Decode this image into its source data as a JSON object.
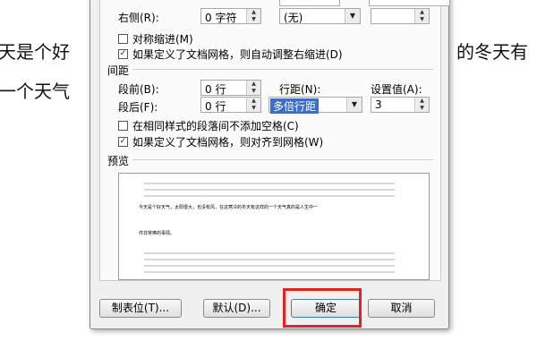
{
  "background": {
    "line1_left": "天是个好",
    "line1_right": "的冬天有",
    "line2_left": "一个天气"
  },
  "dialog": {
    "indent": {
      "right_label": "右侧(R):",
      "right_value": "0 字符",
      "special_value": "(无)",
      "by_value": "",
      "mirror_indent_label": "对称缩进(M)",
      "mirror_indent_checked": false,
      "auto_adjust_label": "如果定义了文档网格，则自动调整右缩进(D)",
      "auto_adjust_checked": true
    },
    "spacing": {
      "title": "间距",
      "before_label": "段前(B):",
      "before_value": "0 行",
      "after_label": "段后(F):",
      "after_value": "0 行",
      "line_spacing_label": "行距(N):",
      "line_spacing_value": "多倍行距",
      "set_value_label": "设置值(A):",
      "set_value": "3",
      "no_space_same_style_label": "在相同样式的段落间不添加空格(C)",
      "no_space_same_style_checked": false,
      "snap_to_grid_label": "如果定义了文档网格，则对齐到网格(W)",
      "snap_to_grid_checked": true
    },
    "preview": {
      "title": "预览",
      "sample_line1": "今天是个好天气，太阳很大，也没有风，在这寒冷的冬天有这样的一个天气真的是人生中一",
      "sample_line2": "件非常棒的事情。"
    },
    "buttons": {
      "tabs": "制表位(T)...",
      "default": "默认(D)...",
      "ok": "确定",
      "cancel": "取消"
    }
  },
  "colors": {
    "highlight": "#e02424",
    "selection": "#3a6fc4"
  }
}
